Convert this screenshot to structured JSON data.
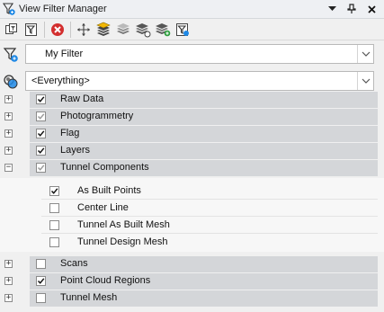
{
  "window": {
    "title": "View Filter Manager",
    "controls": [
      "chevron-down-icon",
      "pin-icon",
      "close-icon"
    ]
  },
  "toolbar": {
    "tools": [
      "copy-filter-icon",
      "filter-properties-icon",
      "delete-icon",
      "move-icon",
      "layers-yellow-icon",
      "layers-grey-icon",
      "layers-tools-icon",
      "layers-add-icon",
      "filter-settings-icon"
    ]
  },
  "filter": {
    "value": "My Filter"
  },
  "scope": {
    "value": "<Everything>"
  },
  "tree": {
    "categories_top": [
      {
        "label": "Raw Data",
        "state": "checked"
      },
      {
        "label": "Photogrammetry",
        "state": "partial"
      },
      {
        "label": "Flag",
        "state": "checked"
      },
      {
        "label": "Layers",
        "state": "checked"
      },
      {
        "label": "Tunnel Components",
        "state": "partial",
        "expanded": true
      }
    ],
    "children": [
      {
        "label": "As Built Points",
        "state": "checked"
      },
      {
        "label": "Center Line",
        "state": "unchecked"
      },
      {
        "label": "Tunnel As Built Mesh",
        "state": "unchecked"
      },
      {
        "label": "Tunnel Design Mesh",
        "state": "unchecked"
      }
    ],
    "categories_bottom": [
      {
        "label": "Scans",
        "state": "unchecked"
      },
      {
        "label": "Point Cloud Regions",
        "state": "checked"
      },
      {
        "label": "Tunnel Mesh",
        "state": "unchecked"
      }
    ]
  }
}
